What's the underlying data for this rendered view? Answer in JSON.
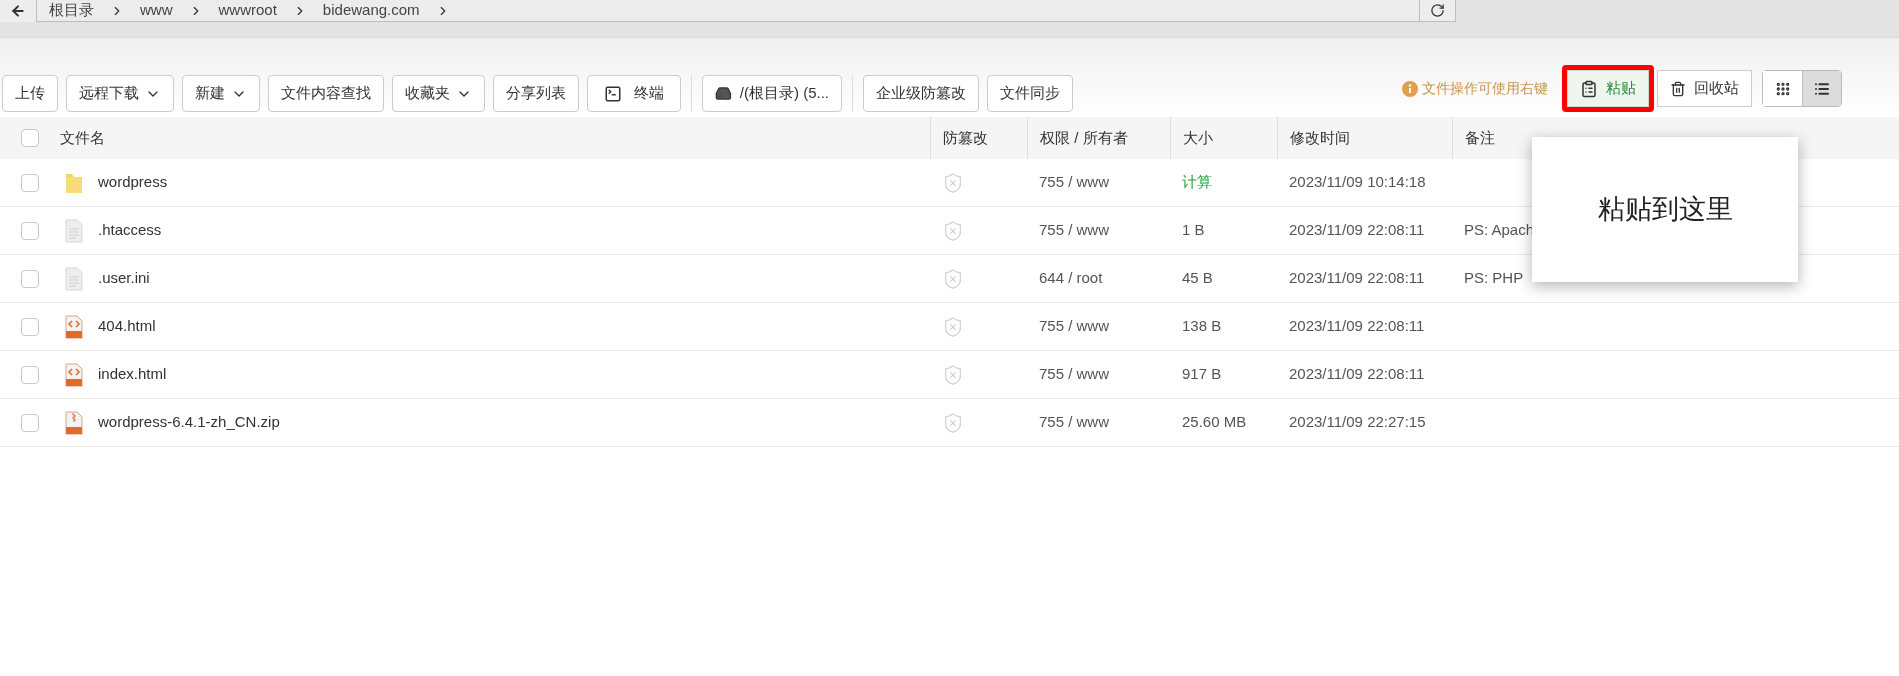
{
  "breadcrumb": {
    "items": [
      "根目录",
      "www",
      "wwwroot",
      "bidewang.com"
    ]
  },
  "toolbar": {
    "button_groups": [
      [
        {
          "label": "上传",
          "kind": "plain"
        },
        {
          "label": "远程下载",
          "kind": "dropdown"
        },
        {
          "label": "新建",
          "kind": "dropdown"
        },
        {
          "label": "文件内容查找",
          "kind": "plain"
        },
        {
          "label": "收藏夹",
          "kind": "dropdown"
        },
        {
          "label": "分享列表",
          "kind": "plain"
        },
        {
          "label": "终端",
          "kind": "terminal"
        }
      ],
      [
        {
          "label": "/(根目录) (5...",
          "kind": "disk"
        }
      ],
      [
        {
          "label": "企业级防篡改",
          "kind": "plain"
        },
        {
          "label": "文件同步",
          "kind": "plain"
        }
      ]
    ],
    "hint": "文件操作可使用右键",
    "paste_button": {
      "label": "粘贴",
      "highlighted": true
    },
    "recycle_button": {
      "label": "回收站"
    },
    "view_modes": [
      {
        "kind": "grid",
        "selected": false
      },
      {
        "kind": "list",
        "selected": true
      }
    ]
  },
  "table": {
    "select_all": {
      "checked": false
    },
    "columns": [
      "文件名",
      "防篡改",
      "权限 / 所有者",
      "大小",
      "修改时间",
      "备注"
    ],
    "rows": [
      {
        "name": "wordpress",
        "kind": "folder",
        "checked": false,
        "permission": "755 / www",
        "size": "计算",
        "size_is_link": true,
        "modified": "2023/11/09 10:14:18"
      },
      {
        "name": ".htaccess",
        "kind": "text",
        "checked": false,
        "permission": "755 / www",
        "size": "1 B",
        "size_is_link": false,
        "modified": "2023/11/09 22:08:11",
        "note": "PS: Apach"
      },
      {
        "name": ".user.ini",
        "kind": "text",
        "checked": false,
        "permission": "644 / root",
        "size": "45 B",
        "size_is_link": false,
        "modified": "2023/11/09 22:08:11",
        "note": "PS: PHP"
      },
      {
        "name": "404.html",
        "kind": "html",
        "checked": false,
        "permission": "755 / www",
        "size": "138 B",
        "size_is_link": false,
        "modified": "2023/11/09 22:08:11"
      },
      {
        "name": "index.html",
        "kind": "html",
        "checked": false,
        "permission": "755 / www",
        "size": "917 B",
        "size_is_link": false,
        "modified": "2023/11/09 22:08:11"
      },
      {
        "name": "wordpress-6.4.1-zh_CN.zip",
        "kind": "zip",
        "checked": false,
        "permission": "755 / www",
        "size": "25.60 MB",
        "size_is_link": false,
        "modified": "2023/11/09 22:27:15"
      }
    ]
  },
  "context_popup": {
    "text": "粘贴到这里"
  }
}
